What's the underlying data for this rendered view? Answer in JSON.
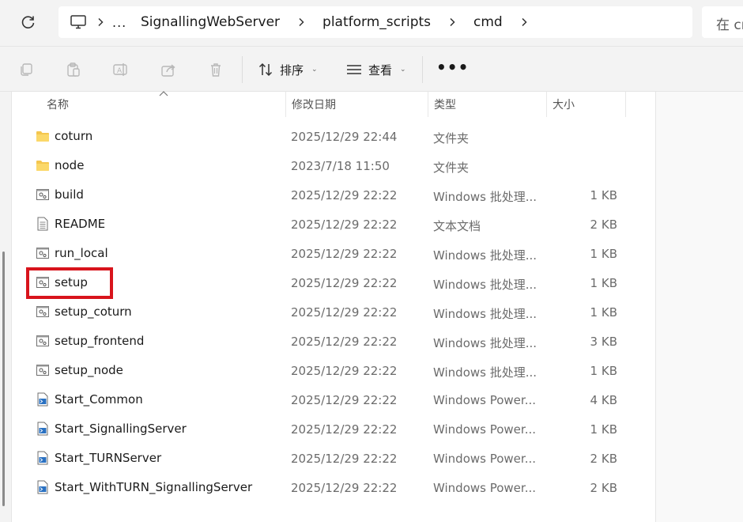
{
  "breadcrumb": {
    "overflow": "...",
    "items": [
      "SignallingWebServer",
      "platform_scripts",
      "cmd"
    ]
  },
  "search": {
    "placeholder": "在 cmd 中搜索"
  },
  "toolbar": {
    "sort_label": "排序",
    "view_label": "查看",
    "more_label": "•••"
  },
  "columns": {
    "name": "名称",
    "modified": "修改日期",
    "type": "类型",
    "size": "大小"
  },
  "files": [
    {
      "name": "coturn",
      "modified": "2025/12/29 22:44",
      "type": "文件夹",
      "size": "",
      "icon": "folder-icon"
    },
    {
      "name": "node",
      "modified": "2023/7/18 11:50",
      "type": "文件夹",
      "size": "",
      "icon": "folder-icon"
    },
    {
      "name": "build",
      "modified": "2025/12/29 22:22",
      "type": "Windows 批处理...",
      "size": "1 KB",
      "icon": "batch-file-icon"
    },
    {
      "name": "README",
      "modified": "2025/12/29 22:22",
      "type": "文本文档",
      "size": "2 KB",
      "icon": "text-file-icon"
    },
    {
      "name": "run_local",
      "modified": "2025/12/29 22:22",
      "type": "Windows 批处理...",
      "size": "1 KB",
      "icon": "batch-file-icon"
    },
    {
      "name": "setup",
      "modified": "2025/12/29 22:22",
      "type": "Windows 批处理...",
      "size": "1 KB",
      "icon": "batch-file-icon"
    },
    {
      "name": "setup_coturn",
      "modified": "2025/12/29 22:22",
      "type": "Windows 批处理...",
      "size": "1 KB",
      "icon": "batch-file-icon"
    },
    {
      "name": "setup_frontend",
      "modified": "2025/12/29 22:22",
      "type": "Windows 批处理...",
      "size": "3 KB",
      "icon": "batch-file-icon"
    },
    {
      "name": "setup_node",
      "modified": "2025/12/29 22:22",
      "type": "Windows 批处理...",
      "size": "1 KB",
      "icon": "batch-file-icon"
    },
    {
      "name": "Start_Common",
      "modified": "2025/12/29 22:22",
      "type": "Windows Power...",
      "size": "4 KB",
      "icon": "powershell-file-icon"
    },
    {
      "name": "Start_SignallingServer",
      "modified": "2025/12/29 22:22",
      "type": "Windows Power...",
      "size": "1 KB",
      "icon": "powershell-file-icon"
    },
    {
      "name": "Start_TURNServer",
      "modified": "2025/12/29 22:22",
      "type": "Windows Power...",
      "size": "2 KB",
      "icon": "powershell-file-icon"
    },
    {
      "name": "Start_WithTURN_SignallingServer",
      "modified": "2025/12/29 22:22",
      "type": "Windows Power...",
      "size": "2 KB",
      "icon": "powershell-file-icon"
    }
  ],
  "colors": {
    "highlight": "#d8141c",
    "folder": "#f4c64f",
    "background": "#f3f3f3"
  }
}
